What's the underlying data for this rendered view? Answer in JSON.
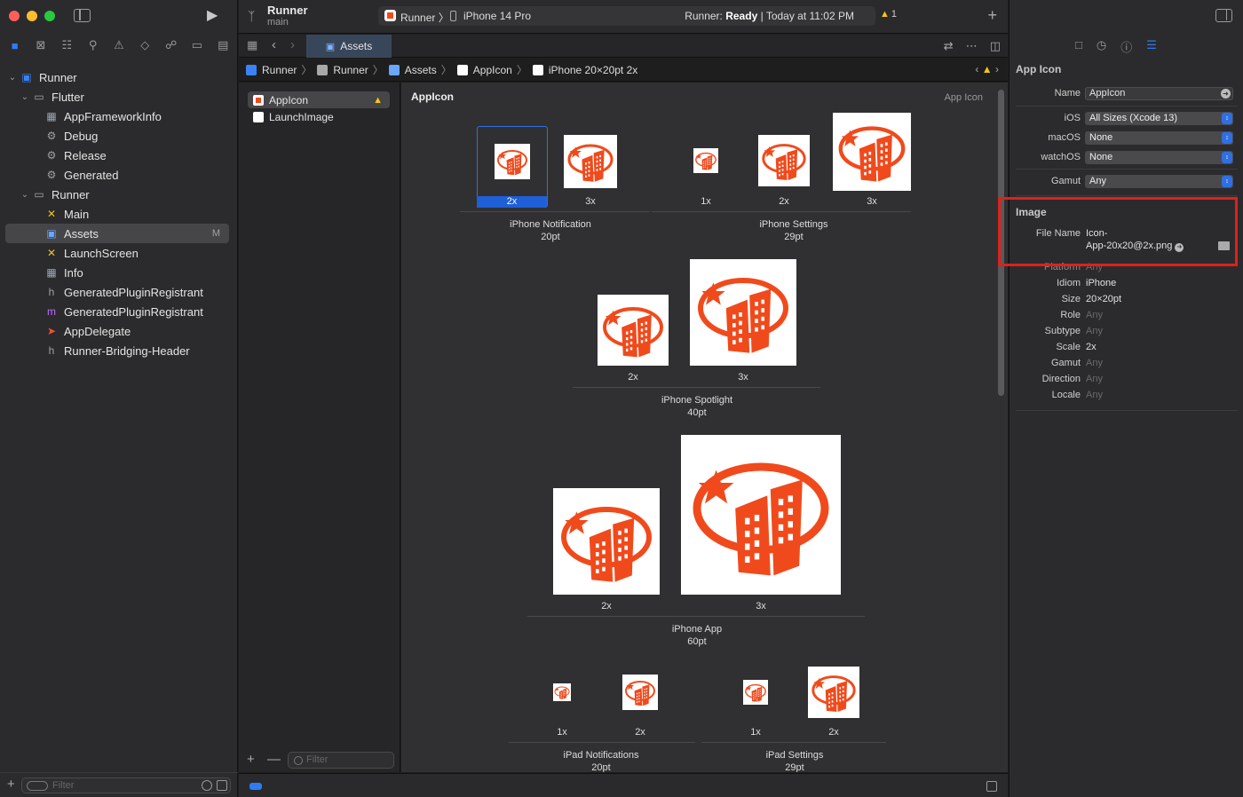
{
  "navigator": {
    "tabs": [
      "folder",
      "source-control",
      "symbols",
      "find",
      "issues",
      "tests",
      "debug",
      "breakpoints",
      "reports"
    ],
    "tree": [
      {
        "label": "Runner",
        "level": 0,
        "expanded": true,
        "icon": "project-icon"
      },
      {
        "label": "Flutter",
        "level": 1,
        "expanded": true,
        "icon": "folder-icon"
      },
      {
        "label": "AppFrameworkInfo",
        "level": 2,
        "icon": "plist-icon"
      },
      {
        "label": "Debug",
        "level": 2,
        "icon": "xcconfig-icon"
      },
      {
        "label": "Release",
        "level": 2,
        "icon": "xcconfig-icon"
      },
      {
        "label": "Generated",
        "level": 2,
        "icon": "xcconfig-icon"
      },
      {
        "label": "Runner",
        "level": 1,
        "expanded": true,
        "icon": "folder-icon"
      },
      {
        "label": "Main",
        "level": 2,
        "icon": "storyboard-icon"
      },
      {
        "label": "Assets",
        "level": 2,
        "icon": "asset-catalog-icon",
        "badge": "M",
        "selected": true
      },
      {
        "label": "LaunchScreen",
        "level": 2,
        "icon": "storyboard-icon"
      },
      {
        "label": "Info",
        "level": 2,
        "icon": "plist-icon"
      },
      {
        "label": "GeneratedPluginRegistrant",
        "level": 2,
        "icon": "header-icon"
      },
      {
        "label": "GeneratedPluginRegistrant",
        "level": 2,
        "icon": "objc-icon"
      },
      {
        "label": "AppDelegate",
        "level": 2,
        "icon": "swift-icon"
      },
      {
        "label": "Runner-Bridging-Header",
        "level": 2,
        "icon": "header-icon"
      }
    ],
    "filter_placeholder": "Filter"
  },
  "toolbar": {
    "project": "Runner",
    "branch": "main",
    "scheme": "Runner",
    "device": "iPhone 14 Pro",
    "status_prefix": "Runner: ",
    "status_bold": "Ready",
    "status_suffix": " | Today at 11:02 PM",
    "warning_count": "1"
  },
  "tabbar": {
    "active_tab": "Assets"
  },
  "jumpbar": {
    "crumbs": [
      "Runner",
      "Runner",
      "Assets",
      "AppIcon",
      "iPhone 20×20pt 2x"
    ]
  },
  "asset_list": {
    "items": [
      {
        "label": "AppIcon",
        "selected": true,
        "warning": true
      },
      {
        "label": "LaunchImage",
        "selected": false,
        "warning": false
      }
    ],
    "filter_placeholder": "Filter"
  },
  "editor": {
    "title": "AppIcon",
    "kind": "App Icon",
    "groups": [
      {
        "name": "iPhone Notification",
        "size": "20pt",
        "slots": [
          "2x",
          "3x"
        ]
      },
      {
        "name": "iPhone Settings",
        "size": "29pt",
        "slots": [
          "1x",
          "2x",
          "3x"
        ]
      },
      {
        "name": "iPhone Spotlight",
        "size": "40pt",
        "slots": [
          "2x",
          "3x"
        ]
      },
      {
        "name": "iPhone App",
        "size": "60pt",
        "slots": [
          "2x",
          "3x"
        ]
      },
      {
        "name": "iPad Notifications",
        "size": "20pt",
        "slots": [
          "1x",
          "2x"
        ]
      },
      {
        "name": "iPad Settings",
        "size": "29pt",
        "slots": [
          "1x",
          "2x"
        ]
      }
    ]
  },
  "inspector": {
    "app_icon_section": "App Icon",
    "name_label": "Name",
    "name_value": "AppIcon",
    "ios_label": "iOS",
    "ios_value": "All Sizes (Xcode 13)",
    "macos_label": "macOS",
    "macos_value": "None",
    "watchos_label": "watchOS",
    "watchos_value": "None",
    "gamut_label": "Gamut",
    "gamut_value": "Any",
    "image_section": "Image",
    "filename_label": "File Name",
    "filename_line1": "Icon-",
    "filename_line2": "App-20x20@2x.png",
    "props": [
      {
        "label": "Platform",
        "value": "Any",
        "dim": true
      },
      {
        "label": "Idiom",
        "value": "iPhone",
        "dim": false
      },
      {
        "label": "Size",
        "value": "20×20pt",
        "dim": false
      },
      {
        "label": "Role",
        "value": "Any",
        "dim": true
      },
      {
        "label": "Subtype",
        "value": "Any",
        "dim": true
      },
      {
        "label": "Scale",
        "value": "2x",
        "dim": false
      },
      {
        "label": "Gamut",
        "value": "Any",
        "dim": true
      },
      {
        "label": "Direction",
        "value": "Any",
        "dim": true
      },
      {
        "label": "Locale",
        "value": "Any",
        "dim": true
      }
    ]
  },
  "colors": {
    "accent": "#2f7bf5",
    "icon_orange": "#f04a1c",
    "highlight": "#e0201c"
  }
}
